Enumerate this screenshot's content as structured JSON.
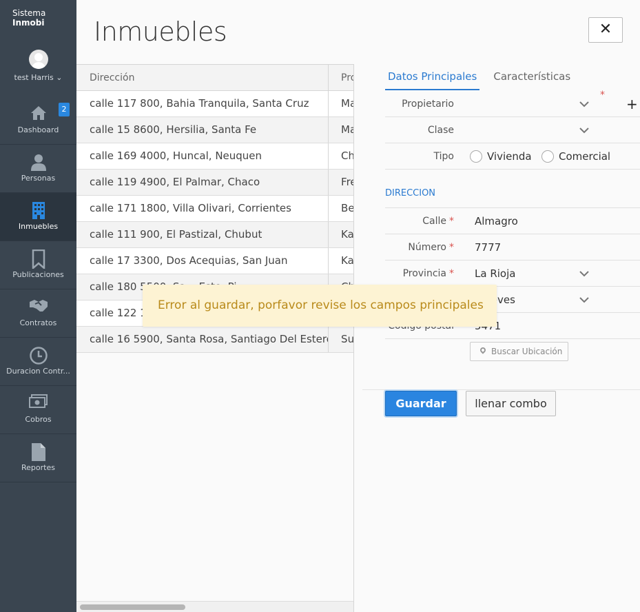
{
  "sidebar": {
    "brand_line1": "Sistema",
    "brand_line2": "Inmobi",
    "user_name": "test Harris",
    "items": [
      {
        "label": "Dashboard",
        "icon": "home-icon",
        "badge": "2"
      },
      {
        "label": "Personas",
        "icon": "person-icon"
      },
      {
        "label": "Inmuebles",
        "icon": "building-icon",
        "active": true
      },
      {
        "label": "Publicaciones",
        "icon": "bookmark-icon"
      },
      {
        "label": "Contratos",
        "icon": "handshake-icon"
      },
      {
        "label": "Duracion Contr...",
        "icon": "clock-icon"
      },
      {
        "label": "Cobros",
        "icon": "money-icon"
      },
      {
        "label": "Reportes",
        "icon": "document-icon"
      }
    ]
  },
  "header": {
    "title": "Inmuebles",
    "close_label": "✕"
  },
  "table": {
    "columns": [
      "Dirección",
      "Pro"
    ],
    "rows": [
      [
        "calle 117 800, Bahia Tranquila, Santa Cruz",
        "Ma"
      ],
      [
        "calle 15 8600, Hersilia, Santa Fe",
        "Ma"
      ],
      [
        "calle 169 4000, Huncal, Neuquen",
        "Ch"
      ],
      [
        "calle 119 4900, El Palmar, Chaco",
        "Fre"
      ],
      [
        "calle 171 1800, Villa Olivari, Corrientes",
        "Be"
      ],
      [
        "calle 111 900, El Pastizal, Chubut",
        "Ka"
      ],
      [
        "calle 17 3300, Dos Acequias, San Juan",
        "Ka"
      ],
      [
        "calle 180 5500, Sa... Este, Pi...",
        "Ch"
      ],
      [
        "calle 122 1...",
        ""
      ],
      [
        "calle 16 5900, Santa Rosa, Santiago Del Estero",
        "Su"
      ]
    ]
  },
  "form": {
    "tabs": [
      "Datos Principales",
      "Características"
    ],
    "propietario_label": "Propietario",
    "clase_label": "Clase",
    "tipo_label": "Tipo",
    "tipo_options": [
      "Vivienda",
      "Comercial"
    ],
    "section_title": "DIRECCION",
    "calle_label": "Calle",
    "calle_value": "Almagro",
    "numero_label": "Número",
    "numero_value": "7777",
    "provincia_label": "Provincia",
    "provincia_value": "La Rioja",
    "localidad_value": "...ueves",
    "codigo_label": "Código postal",
    "codigo_value": "5471",
    "buscar_label": "Buscar Ubicación",
    "save_label": "Guardar",
    "fill_label": "llenar combo"
  },
  "toast": {
    "message": "Error al guardar, porfavor revise los campos principales",
    "color": "#b98a1a"
  },
  "colors": {
    "sidebar_bg": "#3a4550",
    "accent": "#2a85e0",
    "toast_bg": "#fdf3d3"
  }
}
